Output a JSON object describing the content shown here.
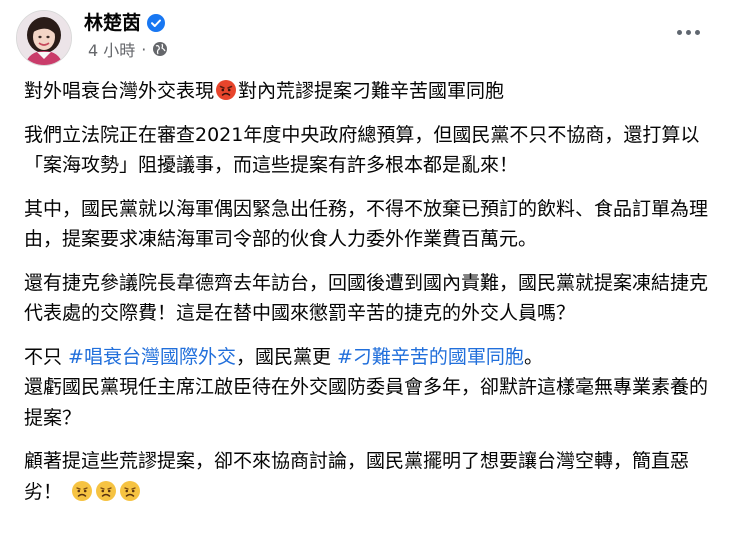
{
  "author": {
    "name": "林楚茵",
    "verified": true,
    "time": "4 小時",
    "separator": "·",
    "audience_icon": "globe-icon"
  },
  "post": {
    "headline_before": "對外唱衰台灣外交表現",
    "headline_emoji": "angry-face-emoji",
    "headline_after": "對內荒謬提案刁難辛苦國軍同胞",
    "p1": "我們立法院正在審查2021年度中央政府總預算，但國民黨不只不協商，還打算以「案海攻勢」阻擾議事，而這些提案有許多根本都是亂來！",
    "p2": "其中，國民黨就以海軍偶因緊急出任務，不得不放棄已預訂的飲料、食品訂單為理由，提案要求凍結海軍司令部的伙食人力委外作業費百萬元。",
    "p3": "還有捷克參議院長韋德齊去年訪台，回國後遭到國內責難，國民黨就提案凍結捷克代表處的交際費！這是在替中國來懲罰辛苦的捷克的外交人員嗎？",
    "p4_pre": "不只 ",
    "hashtag1": "#唱衰台灣國際外交",
    "p4_mid": "，國民黨更 ",
    "hashtag2": "#刁難辛苦的國軍同胞",
    "p4_end": "。",
    "p4_line2": "還虧國民黨現任主席江啟臣待在外交國防委員會多年，卻默許這樣毫無專業素養的提案？",
    "p5": "顧著提這些荒謬提案，卻不來協商討論，國民黨擺明了想要讓台灣空轉，簡直惡劣！",
    "closing_emojis": [
      "frowning-face-emoji",
      "frowning-face-emoji",
      "frowning-face-emoji"
    ]
  },
  "colors": {
    "text": "#050505",
    "secondary": "#65676b",
    "link": "#216fdb",
    "verified": "#1877f2"
  }
}
